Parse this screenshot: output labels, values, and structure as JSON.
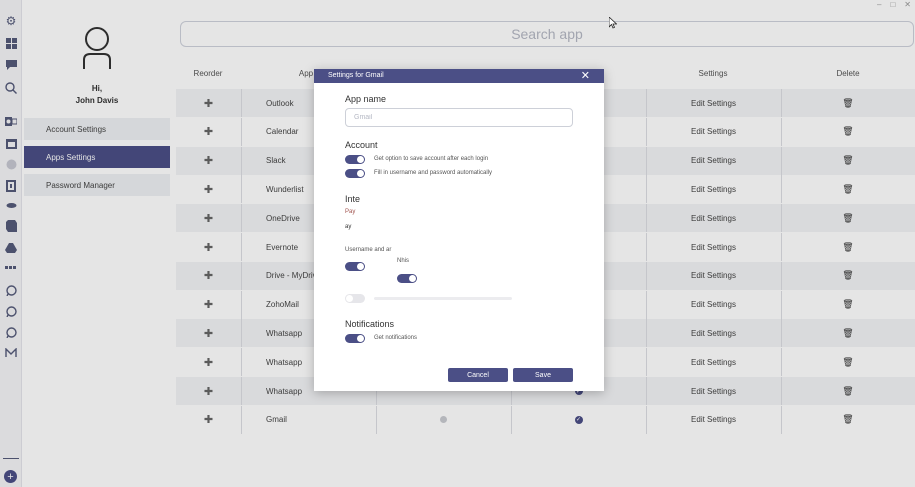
{
  "profile": {
    "greeting": "Hi,",
    "name": "John Davis"
  },
  "sidebar": {
    "items": [
      {
        "label": "Account Settings",
        "active": false
      },
      {
        "label": "Apps Settings",
        "active": true
      },
      {
        "label": "Password Manager",
        "active": false
      }
    ]
  },
  "search": {
    "placeholder": "Search app"
  },
  "table": {
    "headers": [
      "Reorder",
      "App",
      "Settings",
      "Delete"
    ],
    "rows": [
      {
        "app": "Outlook",
        "settings": "Edit Settings"
      },
      {
        "app": "Calendar",
        "settings": "Edit Settings"
      },
      {
        "app": "Slack",
        "settings": "Edit Settings"
      },
      {
        "app": "Wunderlist",
        "settings": "Edit Settings"
      },
      {
        "app": "OneDrive",
        "settings": "Edit Settings"
      },
      {
        "app": "Evernote",
        "settings": "Edit Settings"
      },
      {
        "app": "Drive - MyDrive",
        "settings": "Edit Settings"
      },
      {
        "app": "ZohoMail",
        "settings": "Edit Settings"
      },
      {
        "app": "Whatsapp",
        "settings": "Edit Settings"
      },
      {
        "app": "Whatsapp",
        "settings": "Edit Settings"
      },
      {
        "app": "Whatsapp",
        "settings": "Edit Settings"
      },
      {
        "app": "Gmail",
        "settings": "Edit Settings"
      }
    ]
  },
  "modal": {
    "title": "Settings for Gmail",
    "appname_label": "App name",
    "appname_placeholder": "Gmail",
    "account_label": "Account",
    "toggle_save": "Get option to save account after each login",
    "toggle_fill": "Fill in username and password automatically",
    "interface_label": "Inte",
    "interface_line1": "Pay",
    "interface_line2": "ay",
    "username_label": "Username and ar",
    "notify_label": "Nhis",
    "notifications_label": "Notifications",
    "toggle_notifications": "Get notifications",
    "cancel": "Cancel",
    "save": "Save"
  },
  "colors": {
    "accent": "#4b4f86",
    "row_alt": "#f2f3f5",
    "muted_text": "#b5b8c4"
  },
  "rail_icons": [
    "gear-icon",
    "grid-icon",
    "chat-icon",
    "search-icon",
    "outlook-icon",
    "calendar-icon",
    "slack-icon",
    "wunderlist-icon",
    "onedrive-icon",
    "evernote-icon",
    "drive-icon",
    "zohomail-icon",
    "whatsapp-icon",
    "whatsapp-icon",
    "whatsapp-icon",
    "gmail-icon"
  ]
}
